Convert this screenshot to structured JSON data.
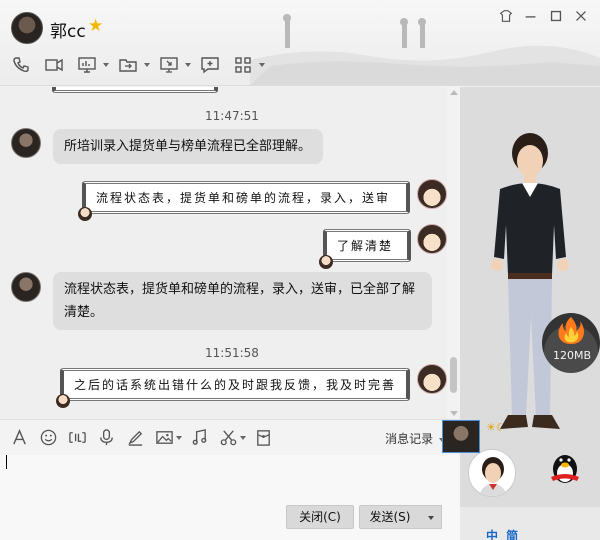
{
  "window": {
    "contact_name": "郭cc",
    "vip_icon": "star-icon"
  },
  "toolbar": {
    "tools": [
      "phone-icon",
      "video-icon",
      "share-screen-icon",
      "file-transfer-icon",
      "remote-desktop-icon",
      "chat-plus-icon",
      "apps-grid-icon"
    ]
  },
  "chat": {
    "messages": [
      {
        "type": "time",
        "text": "11:47:51"
      },
      {
        "type": "incoming",
        "text": "所培训录入提货单与榜单流程已全部理解。"
      },
      {
        "type": "outgoing",
        "text": "流程状态表，提货单和磅单的流程，录入，送审"
      },
      {
        "type": "outgoing",
        "text": "了解清楚"
      },
      {
        "type": "incoming",
        "text_line1": "流程状态表，提货单和磅单的流程，录入，送审，已全部了解",
        "text_line2": "清楚。"
      },
      {
        "type": "time",
        "text": "11:51:58"
      },
      {
        "type": "outgoing",
        "text": "之后的话系统出错什么的及时跟我反馈，我及时完善"
      }
    ]
  },
  "input_toolbar": {
    "tools": [
      "font-icon",
      "emoji-icon",
      "gif-icon",
      "voice-icon",
      "brush-icon",
      "image-icon",
      "music-icon",
      "screenshot-scissors-icon",
      "red-packet-icon"
    ],
    "history_label": "消息记录"
  },
  "actions": {
    "close_label": "关闭(C)",
    "send_label": "发送(S)"
  },
  "right_panel": {
    "storage_label": "120MB",
    "tray_text": "中 简"
  }
}
